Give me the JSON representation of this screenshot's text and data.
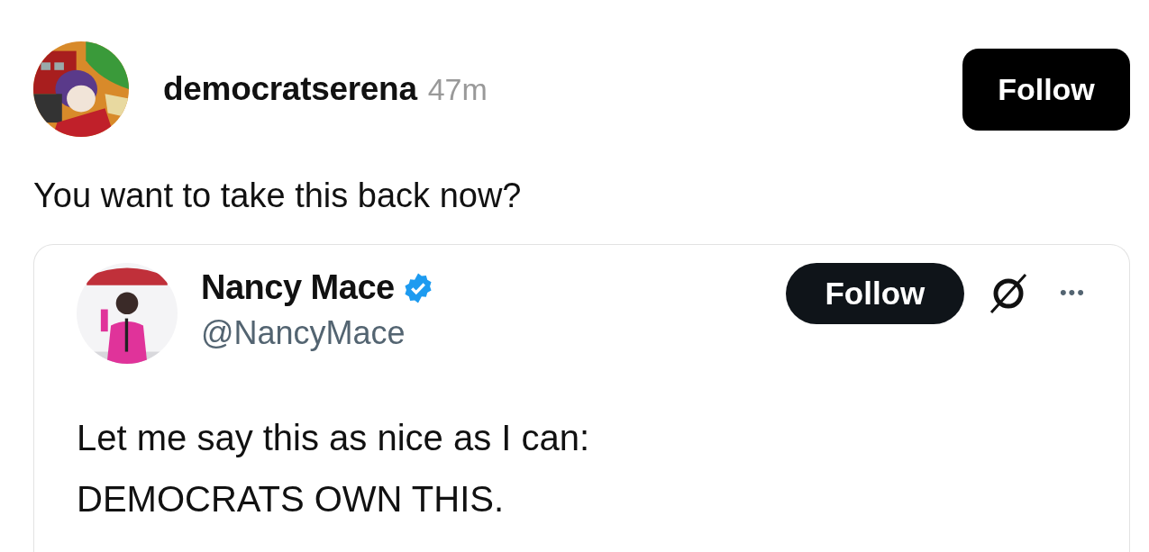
{
  "post": {
    "username": "democratserena",
    "time": "47m",
    "follow_label": "Follow",
    "text": "You want to take this back now?"
  },
  "quoted": {
    "name": "Nancy Mace",
    "verified": true,
    "handle": "@NancyMace",
    "follow_label": "Follow",
    "more": "•••",
    "text_lines": [
      "Let me say this as nice as I can:",
      "DEMOCRATS OWN THIS."
    ]
  }
}
